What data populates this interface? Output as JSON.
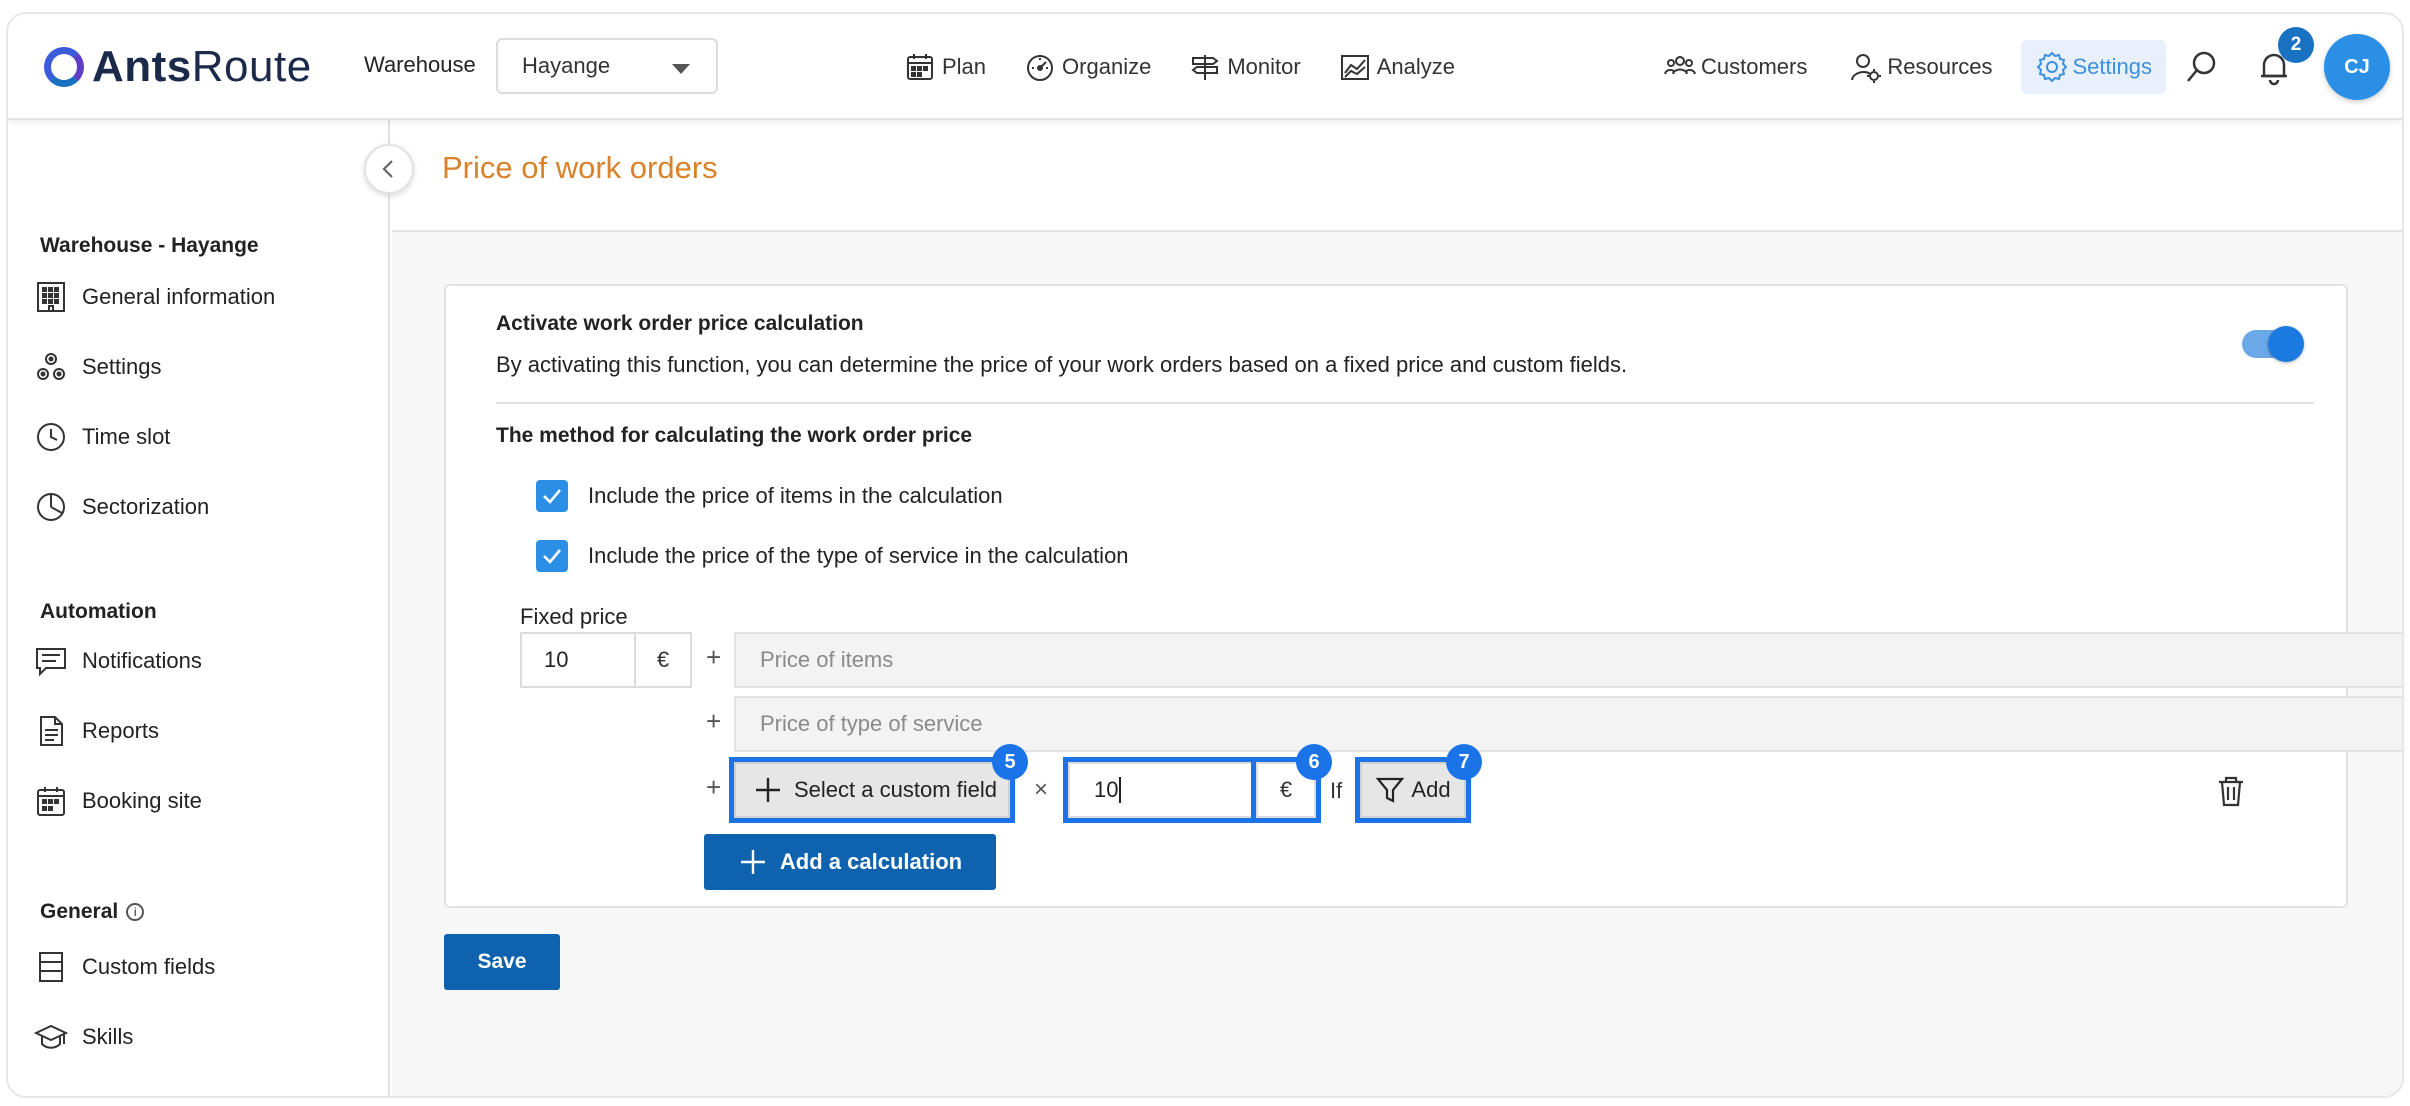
{
  "brand": {
    "name_bold": "Ants",
    "name_regular": "Route"
  },
  "warehouse": {
    "label": "Warehouse",
    "selected": "Hayange"
  },
  "mainnav": [
    {
      "label": "Plan",
      "icon": "calendar-icon"
    },
    {
      "label": "Organize",
      "icon": "speedometer-icon"
    },
    {
      "label": "Monitor",
      "icon": "signpost-icon"
    },
    {
      "label": "Analyze",
      "icon": "chart-icon"
    }
  ],
  "rightnav": {
    "customers": "Customers",
    "resources": "Resources",
    "settings": "Settings",
    "notifications_count": "2",
    "avatar_initials": "CJ"
  },
  "sidebar": {
    "section_warehouse": "Warehouse - Hayange",
    "warehouse_items": [
      "General information",
      "Settings",
      "Time slot",
      "Sectorization"
    ],
    "section_automation": "Automation",
    "automation_items": [
      "Notifications",
      "Reports",
      "Booking site"
    ],
    "section_general": "General",
    "general_items": [
      "Custom fields",
      "Skills"
    ]
  },
  "page": {
    "title": "Price of work orders"
  },
  "card": {
    "activate_title": "Activate work order price calculation",
    "activate_desc": "By activating this function, you can determine the price of your work orders based on a fixed price and custom fields.",
    "activate_enabled": true,
    "method_title": "The method for calculating the work order price",
    "include_items": "Include the price of items in the calculation",
    "include_service": "Include the price of the type of service in the calculation",
    "fixed_price_label": "Fixed price",
    "fixed_price_value": "10",
    "currency": "€",
    "plus": "+",
    "price_items_placeholder": "Price of items",
    "price_service_placeholder": "Price of type of service",
    "select_custom_field": "Select a custom field",
    "times": "×",
    "multiplier_value": "10",
    "if_label": "If",
    "add_filter": "Add",
    "add_calculation": "Add a calculation",
    "badges": [
      "5",
      "6",
      "7"
    ]
  },
  "save_label": "Save",
  "colors": {
    "accent": "#0f62ae",
    "highlight": "#1b73e8",
    "title_orange": "#d9822b",
    "active_nav": "#3d8fe0"
  }
}
